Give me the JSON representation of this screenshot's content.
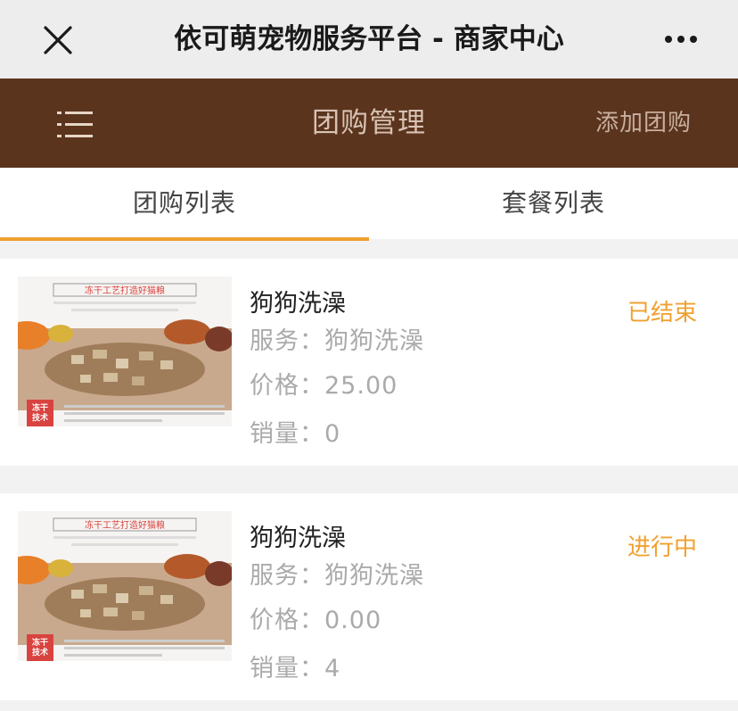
{
  "window": {
    "title": "依可萌宠物服务平台 - 商家中心"
  },
  "header": {
    "title": "团购管理",
    "add_label": "添加团购"
  },
  "tabs": [
    {
      "label": "团购列表",
      "active": true
    },
    {
      "label": "套餐列表",
      "active": false
    }
  ],
  "thumbnail": {
    "headline": "冻干工艺打造好猫粮",
    "badge_line1": "冻干",
    "badge_line2": "技术"
  },
  "items": [
    {
      "name": "狗狗洗澡",
      "service_label": "服务：",
      "service_value": "狗狗洗澡",
      "price_label": "价格：",
      "price_value": "25.00",
      "sales_label": "销量：",
      "sales_value": "0",
      "status": "已结束"
    },
    {
      "name": "狗狗洗澡",
      "service_label": "服务：",
      "service_value": "狗狗洗澡",
      "price_label": "价格：",
      "price_value": "0.00",
      "sales_label": "销量：",
      "sales_value": "4",
      "status": "进行中"
    }
  ],
  "colors": {
    "header_bg": "#5b341d",
    "accent": "#f0a030",
    "badge": "#d9433f"
  }
}
